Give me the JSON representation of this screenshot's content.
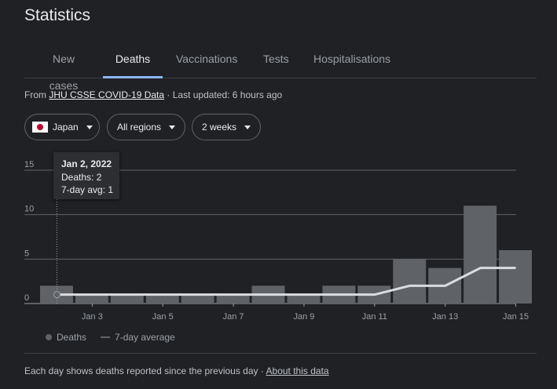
{
  "title": "Statistics",
  "tabs": [
    {
      "label": "New cases"
    },
    {
      "label": "Deaths"
    },
    {
      "label": "Vaccinations"
    },
    {
      "label": "Tests"
    },
    {
      "label": "Hospitalisations"
    }
  ],
  "source": {
    "prefix": "From ",
    "link": "JHU CSSE COVID-19 Data",
    "updated": " · Last updated: 6 hours ago"
  },
  "filters": {
    "country": "Japan",
    "region": "All regions",
    "period": "2 weeks"
  },
  "tooltip": {
    "date": "Jan 2, 2022",
    "deaths": "Deaths: 2",
    "avg": "7-day avg: 1"
  },
  "legend": {
    "deaths": "Deaths",
    "avg": "7-day average"
  },
  "footer": {
    "text": "Each day shows deaths reported since the previous day  · ",
    "link": "About this data"
  },
  "colors": {
    "bar": "#5f6368",
    "line": "#e8eaed",
    "accent": "#8ab4f8"
  },
  "chart_data": {
    "type": "bar",
    "x": [
      "Jan 2",
      "Jan 3",
      "Jan 4",
      "Jan 5",
      "Jan 6",
      "Jan 7",
      "Jan 8",
      "Jan 9",
      "Jan 10",
      "Jan 11",
      "Jan 12",
      "Jan 13",
      "Jan 14",
      "Jan 15"
    ],
    "series": [
      {
        "name": "Deaths",
        "values": [
          2,
          1,
          1,
          1,
          1,
          1,
          2,
          1,
          2,
          2,
          5,
          4,
          11,
          6
        ]
      },
      {
        "name": "7-day average",
        "values": [
          1,
          1,
          1,
          1,
          1,
          1,
          1,
          1,
          1,
          1,
          2,
          2,
          4,
          4
        ]
      }
    ],
    "xticks": [
      "Jan 3",
      "Jan 5",
      "Jan 7",
      "Jan 9",
      "Jan 11",
      "Jan 13",
      "Jan 15"
    ],
    "yticks": [
      "0",
      "5",
      "10",
      "15"
    ],
    "ylim": [
      0,
      15
    ],
    "grid": true,
    "legend": "bottom-left"
  }
}
